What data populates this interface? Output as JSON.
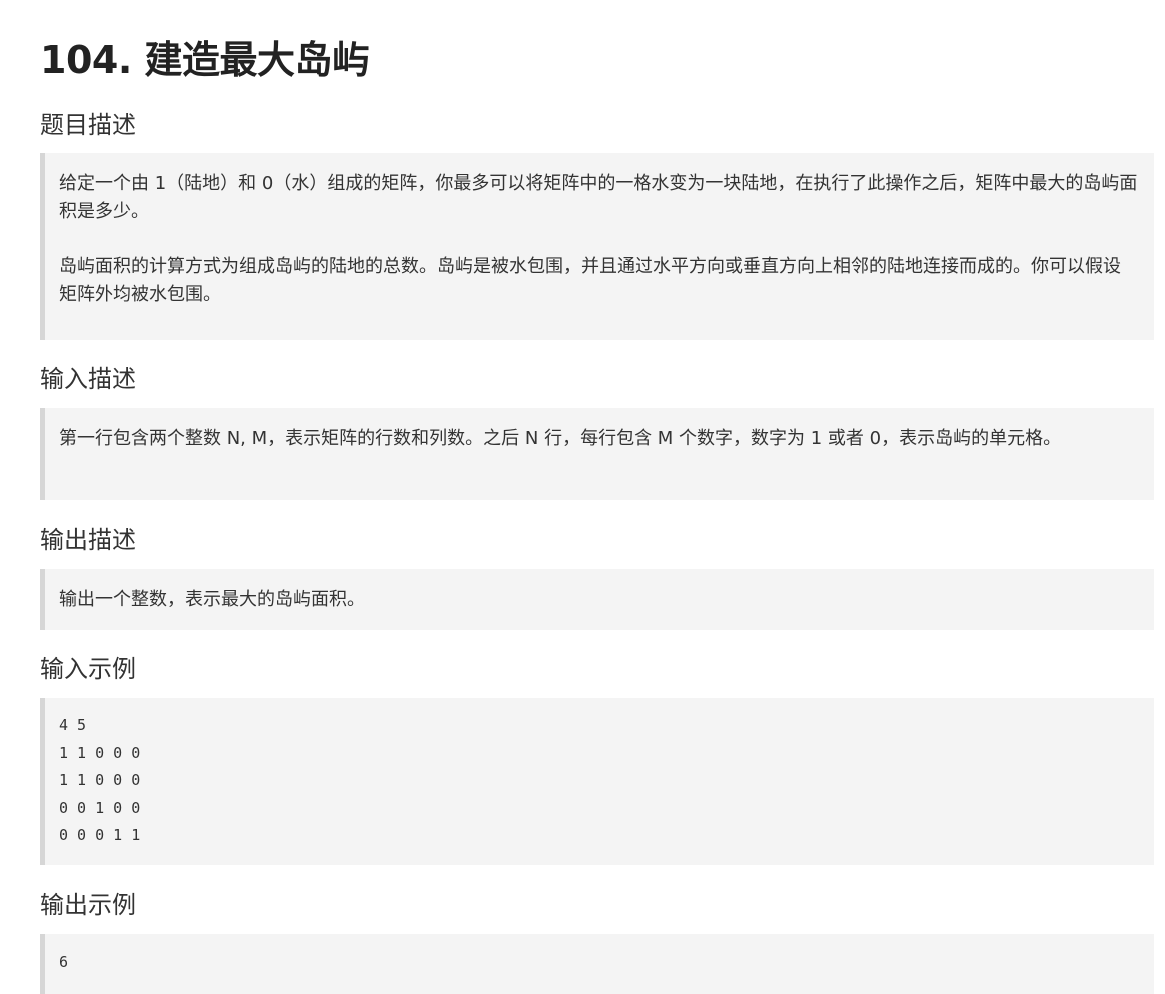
{
  "title": "104. 建造最大岛屿",
  "sections": {
    "description": {
      "heading": "题目描述",
      "paragraphs": [
        "给定一个由 1（陆地）和 0（水）组成的矩阵，你最多可以将矩阵中的一格水变为一块陆地，在执行了此操作之后，矩阵中最大的岛屿面积是多少。",
        "岛屿面积的计算方式为组成岛屿的陆地的总数。岛屿是被水包围，并且通过水平方向或垂直方向上相邻的陆地连接而成的。你可以假设矩阵外均被水包围。"
      ]
    },
    "input_desc": {
      "heading": "输入描述",
      "text": "第一行包含两个整数 N, M，表示矩阵的行数和列数。之后 N 行，每行包含 M 个数字，数字为 1 或者 0，表示岛屿的单元格。"
    },
    "output_desc": {
      "heading": "输出描述",
      "text": "输出一个整数，表示最大的岛屿面积。"
    },
    "input_example": {
      "heading": "输入示例",
      "code": "4 5\n1 1 0 0 0\n1 1 0 0 0\n0 0 1 0 0\n0 0 0 1 1"
    },
    "output_example": {
      "heading": "输出示例",
      "code": "6"
    }
  }
}
